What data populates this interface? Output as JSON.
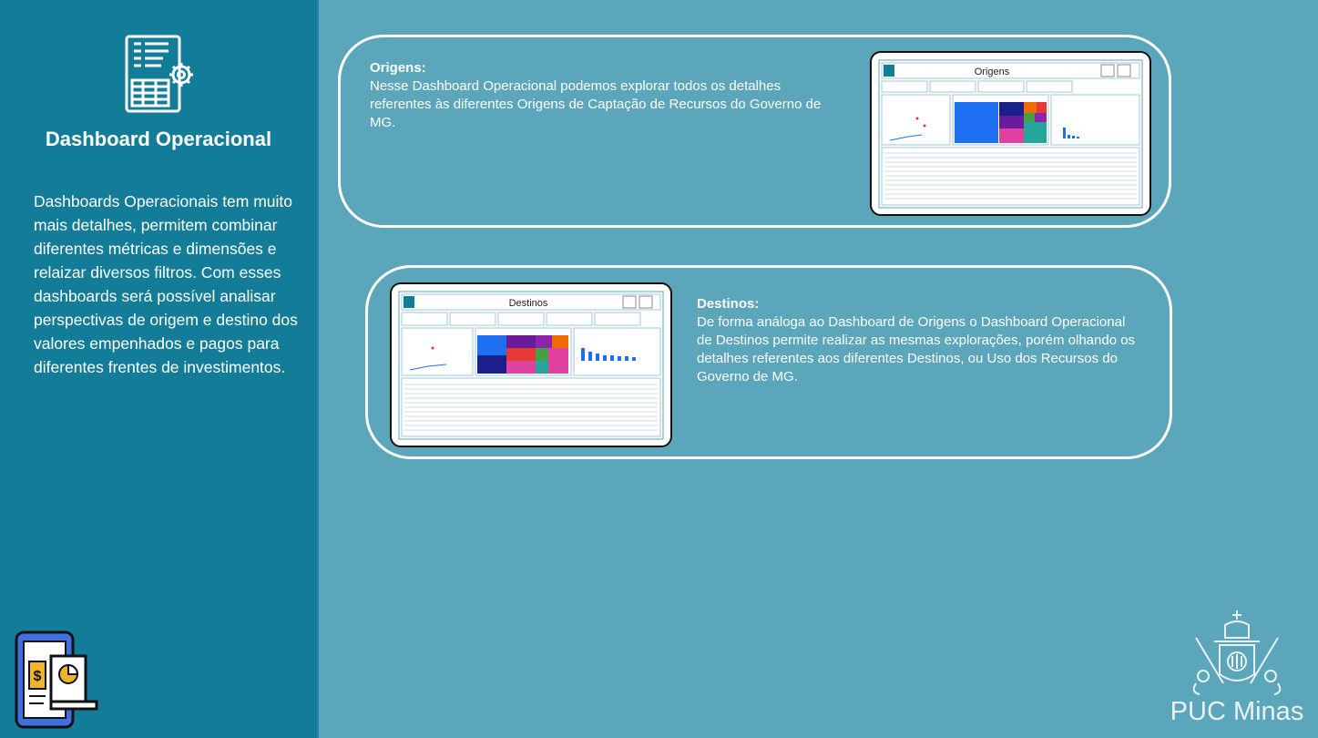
{
  "sidebar": {
    "title": "Dashboard Operacional",
    "description": "Dashboards Operacionais tem muito mais detalhes, permitem combinar diferentes métricas e dimensões e relaizar diversos filtros. Com esses dashboards será possível analisar perspectivas de origem e destino dos valores empenhados e pagos para diferentes frentes de investimentos."
  },
  "panels": [
    {
      "heading": "Origens:",
      "text": "Nesse Dashboard Operacional podemos explorar todos os detalhes referentes às diferentes Origens de Captação de Recursos do Governo de MG.",
      "thumb_title": "Origens"
    },
    {
      "heading": "Destinos:",
      "text": "De forma análoga ao Dashboard de Origens o Dashboard Operacional de Destinos permite realizar as mesmas explorações, porém olhando os detalhes referentes aos diferentes Destinos, ou Uso dos Recursos do Governo de MG.",
      "thumb_title": "Destinos"
    }
  ],
  "brand": {
    "name": "PUC Minas"
  },
  "colors": {
    "sidebar": "#137d99",
    "background": "#5ca6bb",
    "accent": "#f0b429"
  },
  "icons": [
    "document-settings-icon",
    "phone-finance-icon",
    "puc-crest-icon"
  ]
}
